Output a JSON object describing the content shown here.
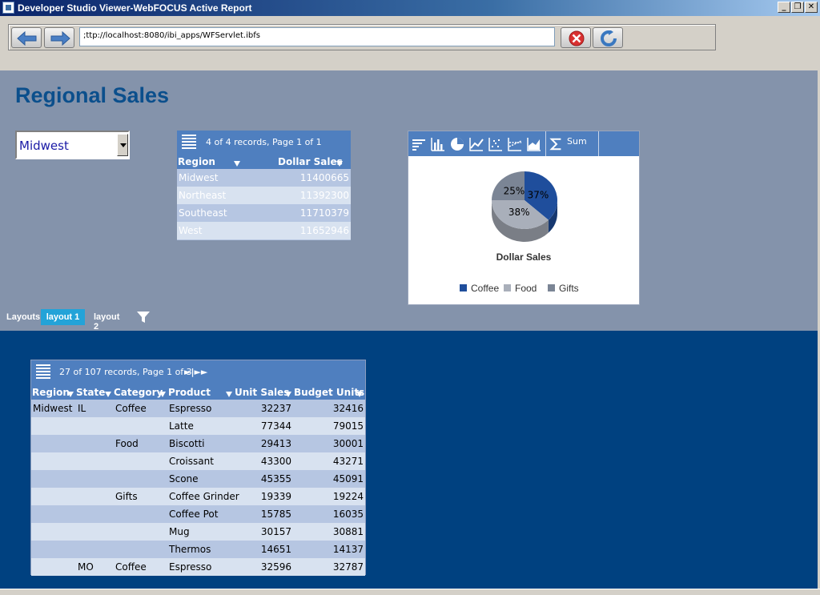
{
  "window": {
    "title": "Developer Studio Viewer-WebFOCUS Active Report"
  },
  "addressbar": {
    "url": ";ttp://localhost:8080/ibi_apps/WFServlet.ibfs"
  },
  "report": {
    "title": "Regional Sales",
    "region_filter": {
      "selected": "Midwest"
    },
    "summary_table": {
      "header_text": "4 of 4 records, Page 1 of 1",
      "columns": [
        "Region",
        "Dollar Sales"
      ],
      "rows": [
        [
          "Midwest",
          "11400665"
        ],
        [
          "Northeast",
          "11392300"
        ],
        [
          "Southeast",
          "11710379"
        ],
        [
          "West",
          "11652946"
        ]
      ]
    },
    "chart": {
      "toolbar": {
        "sum_label": "Sum"
      },
      "colors": {
        "Coffee": "#1f4e9c",
        "Food": "#a9afba",
        "Gifts": "#7b8595"
      }
    },
    "layouts": {
      "label": "Layouts",
      "tabs": [
        "layout 1",
        "layout 2"
      ],
      "active": "layout 1"
    },
    "detail_table": {
      "header_text": "27 of 107 records, Page 1 of 3",
      "pager": "►|►►",
      "columns": [
        "Region",
        "State",
        "Category",
        "Product",
        "Unit Sales",
        "Budget Units"
      ],
      "rows": [
        [
          "Midwest",
          "IL",
          "Coffee",
          "Espresso",
          "32237",
          "32416"
        ],
        [
          "",
          "",
          "",
          "Latte",
          "77344",
          "79015"
        ],
        [
          "",
          "",
          "Food",
          "Biscotti",
          "29413",
          "30001"
        ],
        [
          "",
          "",
          "",
          "Croissant",
          "43300",
          "43271"
        ],
        [
          "",
          "",
          "",
          "Scone",
          "45355",
          "45091"
        ],
        [
          "",
          "",
          "Gifts",
          "Coffee Grinder",
          "19339",
          "19224"
        ],
        [
          "",
          "",
          "",
          "Coffee Pot",
          "15785",
          "16035"
        ],
        [
          "",
          "",
          "",
          "Mug",
          "30157",
          "30881"
        ],
        [
          "",
          "",
          "",
          "Thermos",
          "14651",
          "14137"
        ],
        [
          "",
          "MO",
          "Coffee",
          "Espresso",
          "32596",
          "32787"
        ]
      ]
    }
  },
  "chart_data": {
    "type": "pie",
    "title": "Dollar Sales",
    "categories": [
      "Coffee",
      "Food",
      "Gifts"
    ],
    "values": [
      37,
      38,
      25
    ],
    "value_labels": [
      "37%",
      "38%",
      "25%"
    ],
    "legend_placement": "bottom"
  }
}
